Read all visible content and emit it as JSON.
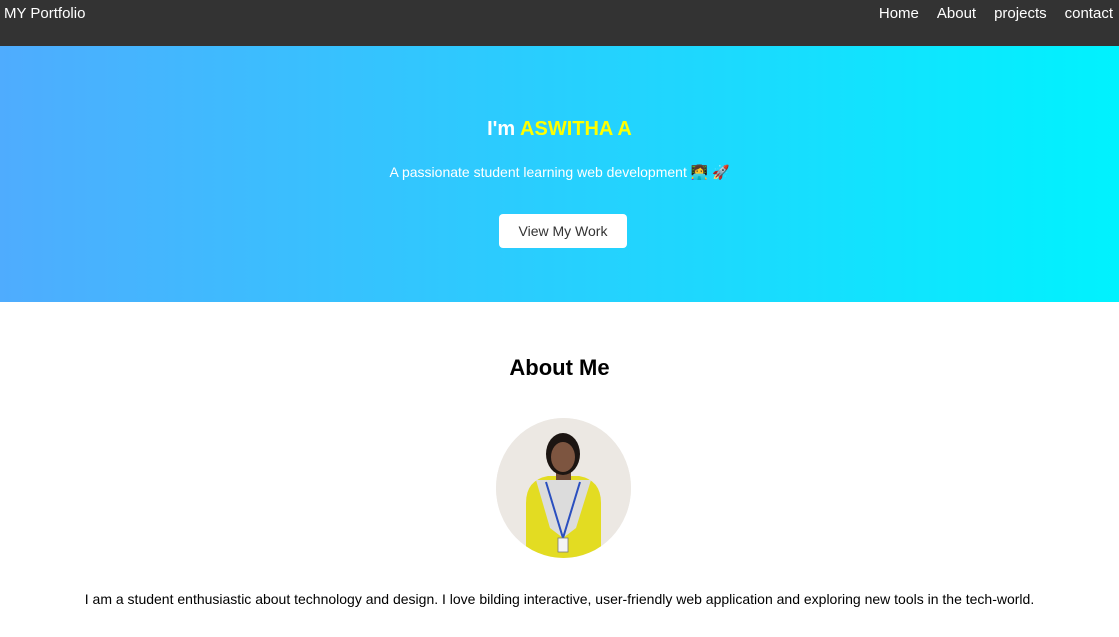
{
  "navbar": {
    "brand": "MY Portfolio",
    "links": [
      "Home",
      "About",
      "projects",
      "contact"
    ]
  },
  "hero": {
    "greeting": "I'm ",
    "name": "ASWITHA A",
    "subtitle": "A passionate student learning web development 👩‍💻 🚀",
    "button_label": "View My Work",
    "gradient_start": "#4facfe",
    "gradient_end": "#00f2fe",
    "name_color": "#ffff00"
  },
  "about": {
    "title": "About Me",
    "description": "I am a student enthusiastic about technology and design. I love bilding interactive, user-friendly web application and exploring new tools in the tech-world."
  },
  "colors": {
    "navbar_bg": "#333333",
    "text_white": "#ffffff"
  }
}
